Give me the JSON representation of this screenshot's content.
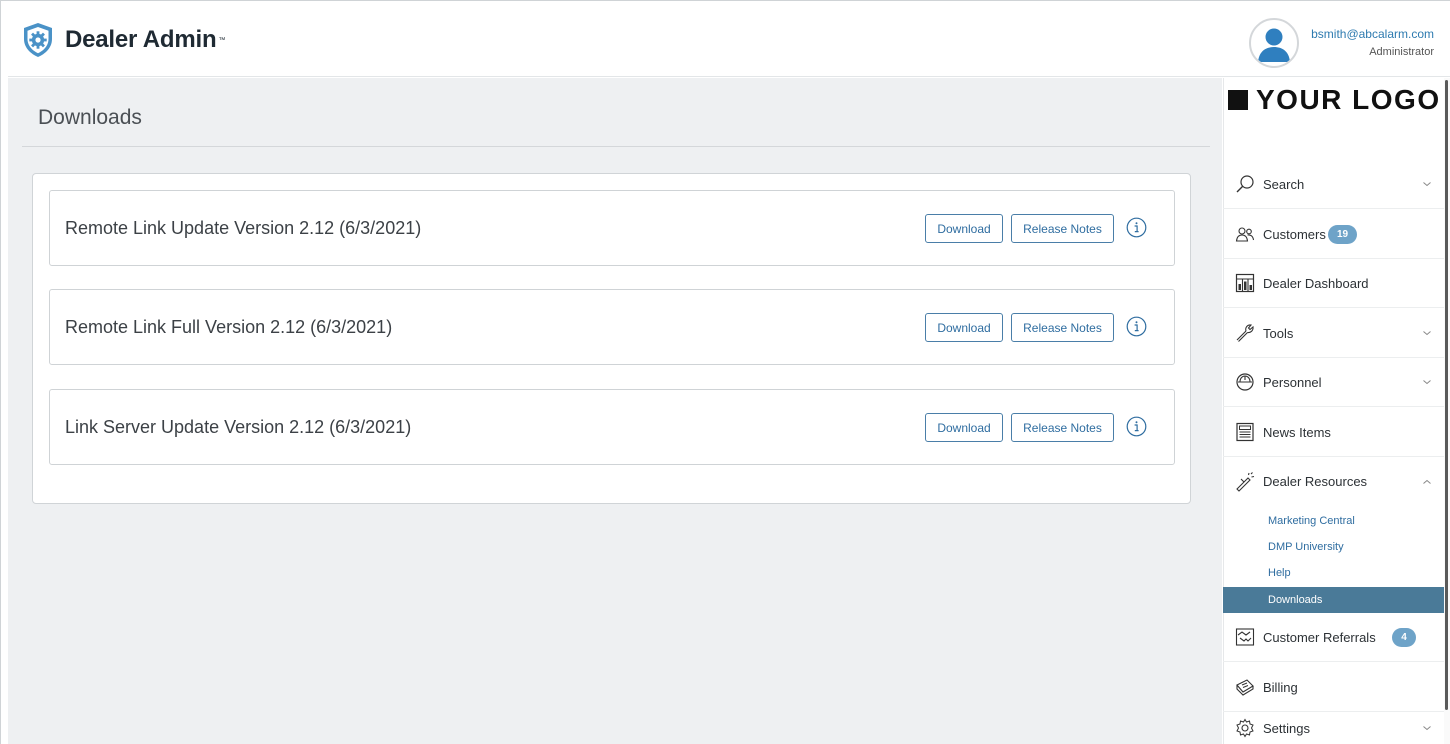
{
  "header": {
    "app_title": "Dealer Admin",
    "trademark": "™",
    "logo_icon": "shield-gear-icon",
    "user": {
      "email": "bsmith@abcalarm.com",
      "role": "Administrator",
      "avatar_icon": "user-avatar-icon"
    }
  },
  "main": {
    "page_title": "Downloads",
    "rows": [
      {
        "title": "Remote Link Update Version 2.12 (6/3/2021)",
        "download_label": "Download",
        "release_notes_label": "Release Notes",
        "info_icon": "info-icon"
      },
      {
        "title": "Remote Link Full Version 2.12 (6/3/2021)",
        "download_label": "Download",
        "release_notes_label": "Release Notes",
        "info_icon": "info-icon"
      },
      {
        "title": "Link Server Update Version 2.12 (6/3/2021)",
        "download_label": "Download",
        "release_notes_label": "Release Notes",
        "info_icon": "info-icon"
      }
    ]
  },
  "sidebar": {
    "brand_logo_text": "YOUR LOGO",
    "items": [
      {
        "label": "Search",
        "icon": "search-icon",
        "expandable": true,
        "expanded": false
      },
      {
        "label": "Customers",
        "icon": "customers-icon",
        "badge": "19"
      },
      {
        "label": "Dealer Dashboard",
        "icon": "dashboard-icon"
      },
      {
        "label": "Tools",
        "icon": "wrench-icon",
        "expandable": true,
        "expanded": false
      },
      {
        "label": "Personnel",
        "icon": "hard-hat-icon",
        "expandable": true,
        "expanded": false
      },
      {
        "label": "News Items",
        "icon": "newspaper-icon"
      },
      {
        "label": "Dealer Resources",
        "icon": "megaphone-icon",
        "expandable": true,
        "expanded": true
      },
      {
        "label": "Customer Referrals",
        "icon": "handshake-icon",
        "badge": "4"
      },
      {
        "label": "Billing",
        "icon": "billing-icon"
      },
      {
        "label": "Settings",
        "icon": "gear-icon",
        "expandable": true,
        "expanded": false
      }
    ],
    "dealer_resources_sub": [
      {
        "label": "Marketing Central",
        "active": false
      },
      {
        "label": "DMP University",
        "active": false
      },
      {
        "label": "Help",
        "active": false
      },
      {
        "label": "Downloads",
        "active": true
      }
    ]
  },
  "colors": {
    "accent": "#2f6da0",
    "badge": "#6ea3c8",
    "active_sub": "#4a7a98",
    "main_bg": "#eef0f2"
  }
}
